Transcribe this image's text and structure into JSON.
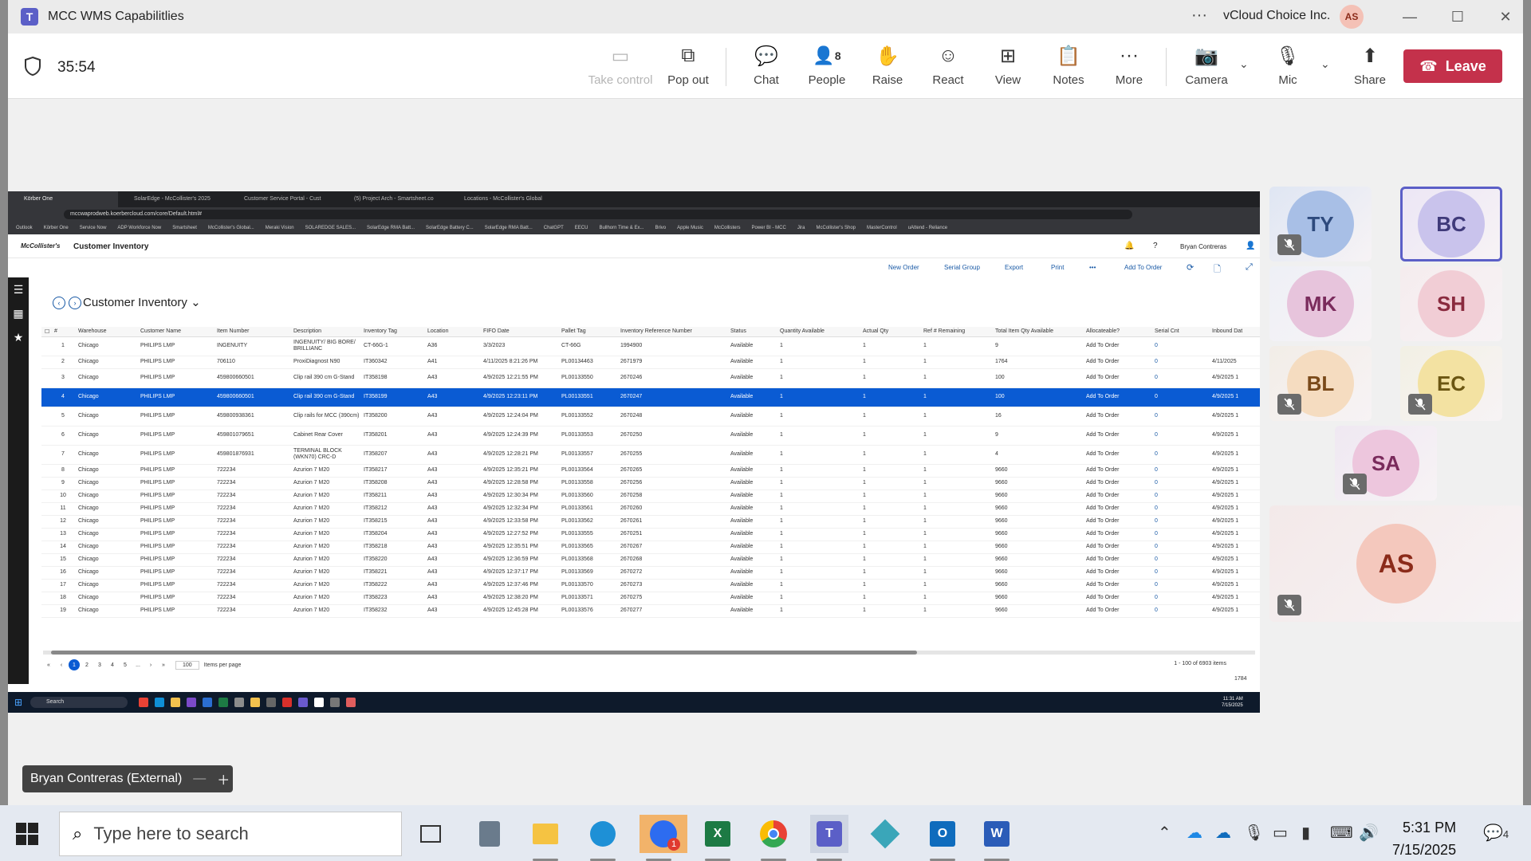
{
  "window": {
    "title": "MCC WMS Capabilitlies",
    "org": "vCloud Choice Inc.",
    "user_initials": "AS"
  },
  "meeting": {
    "timer": "35:54",
    "leave_label": "Leave",
    "people_count": "8",
    "buttons": [
      "Take control",
      "Pop out",
      "Chat",
      "People",
      "Raise",
      "React",
      "View",
      "Notes",
      "More",
      "Camera",
      "Mic",
      "Share"
    ]
  },
  "browser": {
    "tabs": [
      "Körber One",
      "SolarEdge - McCollister's 2025",
      "Customer Service Portal - Cust",
      "(5) Project Arch - Smartsheet.co",
      "Locations - McCollister's Global"
    ],
    "url": "mccwaprodweb.koerbercloud.com/core/Default.html#",
    "bookmarks": [
      "Outlook",
      "Körber One",
      "Service Now",
      "ADP Workforce Now",
      "Smartsheet",
      "McCollister's Global...",
      "Meraki Vision",
      "SOLAREDGE SALES...",
      "SolarEdge RMA Batt...",
      "SolarEdge Battery C...",
      "SolarEdge RMA Batt...",
      "ChatGPT",
      "EECU",
      "Bullhorn Time & Ex...",
      "Brivo",
      "Apple Music",
      "McCollisters",
      "Power BI - MCC",
      "Jira",
      "McCollister's Shop",
      "MasterControl",
      "uAttend - Reliance"
    ]
  },
  "wms": {
    "logo": "McCollister's",
    "section": "Customer Inventory",
    "user": "Bryan Contreras",
    "page_title": "Customer Inventory",
    "actions": [
      "New Order",
      "Serial Group",
      "Export",
      "Print",
      "Add To Order"
    ],
    "columns": [
      "#",
      "Warehouse",
      "Customer Name",
      "Item Number",
      "Description",
      "Inventory Tag",
      "Location",
      "FIFO Date",
      "Pallet Tag",
      "Inventory Reference Number",
      "Status",
      "Quantity Available",
      "Actual Qty",
      "Ref # Remaining",
      "Total Item Qty Available",
      "Allocateable?",
      "Serial Cnt",
      "Inbound Dat"
    ],
    "rows": [
      [
        "1",
        "Chicago",
        "PHILIPS LMP",
        "INGENUITY",
        "INGENUITY/ BIG BORE/ BRILLIANC",
        "CT-66G-1",
        "A36",
        "3/3/2023",
        "CT-66G",
        "1994900",
        "Available",
        "1",
        "1",
        "1",
        "9",
        "Add To Order",
        "0",
        ""
      ],
      [
        "2",
        "Chicago",
        "PHILIPS LMP",
        "706110",
        "ProxiDiagnost N90",
        "IT360342",
        "A41",
        "4/11/2025 8:21:26 PM",
        "PL00134463",
        "2671979",
        "Available",
        "1",
        "1",
        "1",
        "1764",
        "Add To Order",
        "0",
        "4/11/2025"
      ],
      [
        "3",
        "Chicago",
        "PHILIPS LMP",
        "459800660501",
        "Clip rail 390 cm G-Stand",
        "IT358198",
        "A43",
        "4/9/2025 12:21:55 PM",
        "PL00133550",
        "2670246",
        "Available",
        "1",
        "1",
        "1",
        "100",
        "Add To Order",
        "0",
        "4/9/2025 1"
      ],
      [
        "4",
        "Chicago",
        "PHILIPS LMP",
        "459800660501",
        "Clip rail 390 cm G-Stand",
        "IT358199",
        "A43",
        "4/9/2025 12:23:11 PM",
        "PL00133551",
        "2670247",
        "Available",
        "1",
        "1",
        "1",
        "100",
        "Add To Order",
        "0",
        "4/9/2025 1"
      ],
      [
        "5",
        "Chicago",
        "PHILIPS LMP",
        "459800938361",
        "Clip rails for MCC (390cm)",
        "IT358200",
        "A43",
        "4/9/2025 12:24:04 PM",
        "PL00133552",
        "2670248",
        "Available",
        "1",
        "1",
        "1",
        "16",
        "Add To Order",
        "0",
        "4/9/2025 1"
      ],
      [
        "6",
        "Chicago",
        "PHILIPS LMP",
        "459801079651",
        "Cabinet Rear Cover",
        "IT358201",
        "A43",
        "4/9/2025 12:24:39 PM",
        "PL00133553",
        "2670250",
        "Available",
        "1",
        "1",
        "1",
        "9",
        "Add To Order",
        "0",
        "4/9/2025 1"
      ],
      [
        "7",
        "Chicago",
        "PHILIPS LMP",
        "459801876931",
        "TERMINAL BLOCK (WKN70) CRC-D",
        "IT358207",
        "A43",
        "4/9/2025 12:28:21 PM",
        "PL00133557",
        "2670255",
        "Available",
        "1",
        "1",
        "1",
        "4",
        "Add To Order",
        "0",
        "4/9/2025 1"
      ],
      [
        "8",
        "Chicago",
        "PHILIPS LMP",
        "722234",
        "Azurion 7 M20",
        "IT358217",
        "A43",
        "4/9/2025 12:35:21 PM",
        "PL00133564",
        "2670265",
        "Available",
        "1",
        "1",
        "1",
        "9660",
        "Add To Order",
        "0",
        "4/9/2025 1"
      ],
      [
        "9",
        "Chicago",
        "PHILIPS LMP",
        "722234",
        "Azurion 7 M20",
        "IT358208",
        "A43",
        "4/9/2025 12:28:58 PM",
        "PL00133558",
        "2670256",
        "Available",
        "1",
        "1",
        "1",
        "9660",
        "Add To Order",
        "0",
        "4/9/2025 1"
      ],
      [
        "10",
        "Chicago",
        "PHILIPS LMP",
        "722234",
        "Azurion 7 M20",
        "IT358211",
        "A43",
        "4/9/2025 12:30:34 PM",
        "PL00133560",
        "2670258",
        "Available",
        "1",
        "1",
        "1",
        "9660",
        "Add To Order",
        "0",
        "4/9/2025 1"
      ],
      [
        "11",
        "Chicago",
        "PHILIPS LMP",
        "722234",
        "Azurion 7 M20",
        "IT358212",
        "A43",
        "4/9/2025 12:32:34 PM",
        "PL00133561",
        "2670260",
        "Available",
        "1",
        "1",
        "1",
        "9660",
        "Add To Order",
        "0",
        "4/9/2025 1"
      ],
      [
        "12",
        "Chicago",
        "PHILIPS LMP",
        "722234",
        "Azurion 7 M20",
        "IT358215",
        "A43",
        "4/9/2025 12:33:58 PM",
        "PL00133562",
        "2670261",
        "Available",
        "1",
        "1",
        "1",
        "9660",
        "Add To Order",
        "0",
        "4/9/2025 1"
      ],
      [
        "13",
        "Chicago",
        "PHILIPS LMP",
        "722234",
        "Azurion 7 M20",
        "IT358204",
        "A43",
        "4/9/2025 12:27:52 PM",
        "PL00133555",
        "2670251",
        "Available",
        "1",
        "1",
        "1",
        "9660",
        "Add To Order",
        "0",
        "4/9/2025 1"
      ],
      [
        "14",
        "Chicago",
        "PHILIPS LMP",
        "722234",
        "Azurion 7 M20",
        "IT358218",
        "A43",
        "4/9/2025 12:35:51 PM",
        "PL00133565",
        "2670267",
        "Available",
        "1",
        "1",
        "1",
        "9660",
        "Add To Order",
        "0",
        "4/9/2025 1"
      ],
      [
        "15",
        "Chicago",
        "PHILIPS LMP",
        "722234",
        "Azurion 7 M20",
        "IT358220",
        "A43",
        "4/9/2025 12:36:59 PM",
        "PL00133568",
        "2670268",
        "Available",
        "1",
        "1",
        "1",
        "9660",
        "Add To Order",
        "0",
        "4/9/2025 1"
      ],
      [
        "16",
        "Chicago",
        "PHILIPS LMP",
        "722234",
        "Azurion 7 M20",
        "IT358221",
        "A43",
        "4/9/2025 12:37:17 PM",
        "PL00133569",
        "2670272",
        "Available",
        "1",
        "1",
        "1",
        "9660",
        "Add To Order",
        "0",
        "4/9/2025 1"
      ],
      [
        "17",
        "Chicago",
        "PHILIPS LMP",
        "722234",
        "Azurion 7 M20",
        "IT358222",
        "A43",
        "4/9/2025 12:37:46 PM",
        "PL00133570",
        "2670273",
        "Available",
        "1",
        "1",
        "1",
        "9660",
        "Add To Order",
        "0",
        "4/9/2025 1"
      ],
      [
        "18",
        "Chicago",
        "PHILIPS LMP",
        "722234",
        "Azurion 7 M20",
        "IT358223",
        "A43",
        "4/9/2025 12:38:20 PM",
        "PL00133571",
        "2670275",
        "Available",
        "1",
        "1",
        "1",
        "9660",
        "Add To Order",
        "0",
        "4/9/2025 1"
      ],
      [
        "19",
        "Chicago",
        "PHILIPS LMP",
        "722234",
        "Azurion 7 M20",
        "IT358232",
        "A43",
        "4/9/2025 12:45:28 PM",
        "PL00133576",
        "2670277",
        "Available",
        "1",
        "1",
        "1",
        "9660",
        "Add To Order",
        "0",
        "4/9/2025 1"
      ]
    ],
    "selected_row": "4",
    "pager": {
      "pages": [
        "1",
        "2",
        "3",
        "4",
        "5",
        "..."
      ],
      "page_size": "100",
      "page_size_label": "Items per page",
      "count": "1 - 100 of 6903 items",
      "sub_total": "1784"
    }
  },
  "inner_taskbar": {
    "search": "Search",
    "time": "11:31 AM",
    "date": "7/15/2025"
  },
  "participants": [
    {
      "initials": "TY",
      "muted": true
    },
    {
      "initials": "BC",
      "muted": false,
      "selected": true
    },
    {
      "initials": "MK",
      "muted": false
    },
    {
      "initials": "SH",
      "muted": false
    },
    {
      "initials": "BL",
      "muted": true
    },
    {
      "initials": "EC",
      "muted": true
    },
    {
      "initials": "SA",
      "muted": true
    },
    {
      "initials": "AS",
      "muted": true
    }
  ],
  "presenter": "Bryan Contreras (External)",
  "taskbar": {
    "search_placeholder": "Type here to search",
    "time": "5:31 PM",
    "date": "7/15/2025",
    "notif": "4"
  }
}
